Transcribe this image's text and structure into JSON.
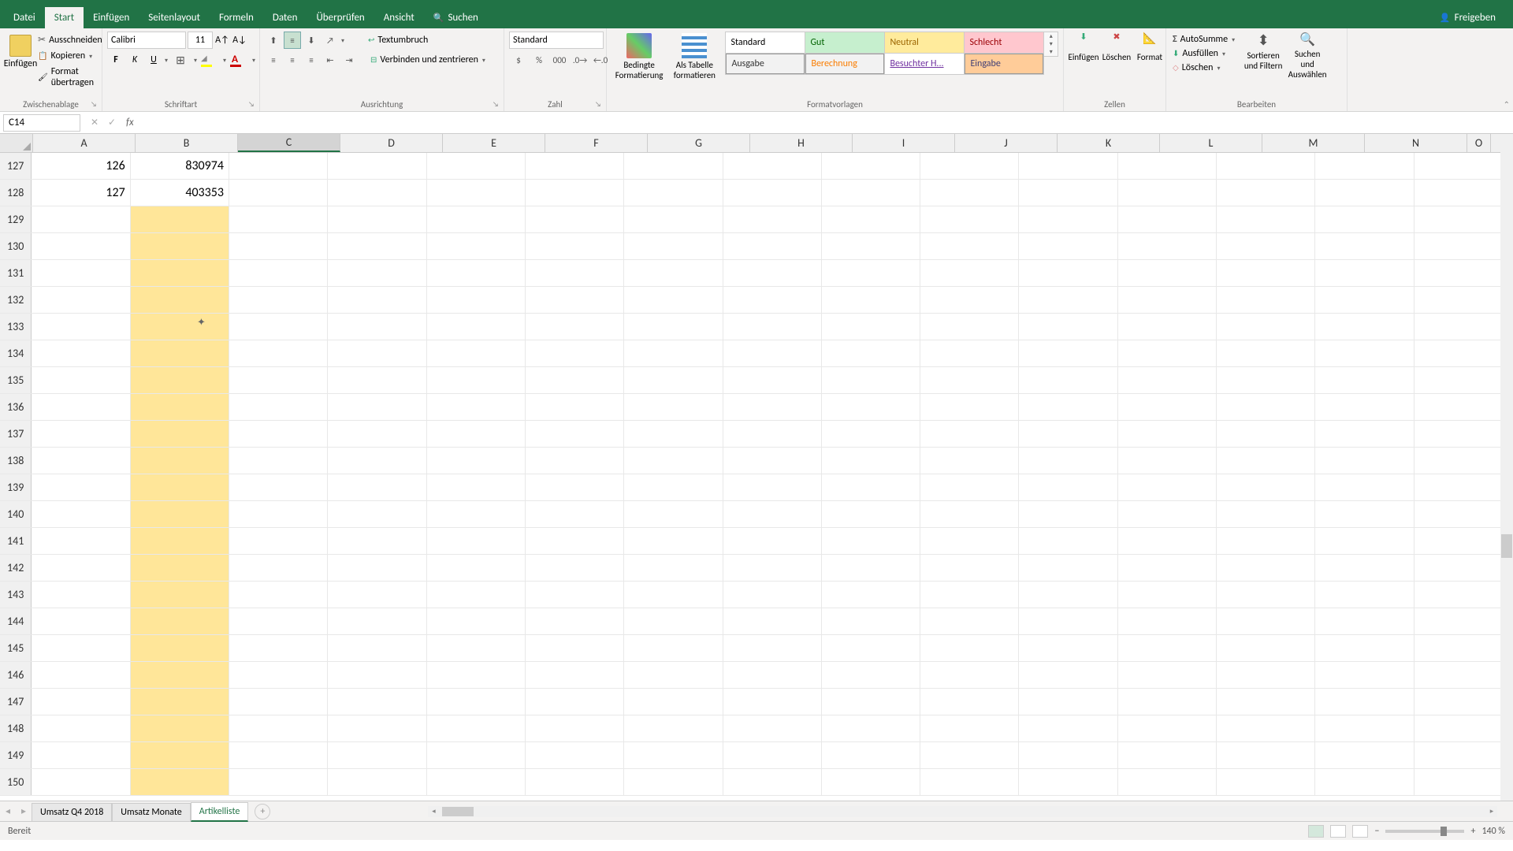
{
  "app": {
    "file_menu": "Datei",
    "share": "Freigeben"
  },
  "tabs": {
    "start": "Start",
    "einfuegen": "Einfügen",
    "seitenlayout": "Seitenlayout",
    "formeln": "Formeln",
    "daten": "Daten",
    "ueberpruefen": "Überprüfen",
    "ansicht": "Ansicht",
    "suchen": "Suchen"
  },
  "clipboard": {
    "paste": "Einfügen",
    "cut": "Ausschneiden",
    "copy": "Kopieren",
    "format_painter": "Format übertragen",
    "group": "Zwischenablage"
  },
  "font": {
    "name": "Calibri",
    "size": "11",
    "bold": "F",
    "italic": "K",
    "underline": "U",
    "group": "Schriftart"
  },
  "align": {
    "wrap": "Textumbruch",
    "merge": "Verbinden und zentrieren",
    "group": "Ausrichtung"
  },
  "number": {
    "format": "Standard",
    "group": "Zahl"
  },
  "styles": {
    "conditional": "Bedingte Formatierung",
    "as_table": "Als Tabelle formatieren",
    "standard": "Standard",
    "gut": "Gut",
    "neutral": "Neutral",
    "schlecht": "Schlecht",
    "ausgabe": "Ausgabe",
    "berechnung": "Berechnung",
    "besuchter": "Besuchter H...",
    "eingabe": "Eingabe",
    "group": "Formatvorlagen"
  },
  "cells": {
    "insert": "Einfügen",
    "delete": "Löschen",
    "format": "Format",
    "group": "Zellen"
  },
  "editing": {
    "autosum": "AutoSumme",
    "fill": "Ausfüllen",
    "clear": "Löschen",
    "sort": "Sortieren und Filtern",
    "find": "Suchen und Auswählen",
    "group": "Bearbeiten"
  },
  "namebox": {
    "cell_ref": "C14",
    "fx": "fx"
  },
  "columns": [
    "A",
    "B",
    "C",
    "D",
    "E",
    "F",
    "G",
    "H",
    "I",
    "J",
    "K",
    "L",
    "M",
    "N",
    "O"
  ],
  "rows": [
    {
      "num": "127",
      "a": "126",
      "b": "830974"
    },
    {
      "num": "128",
      "a": "127",
      "b": "403353"
    },
    {
      "num": "129",
      "a": "",
      "b": ""
    },
    {
      "num": "130",
      "a": "",
      "b": ""
    },
    {
      "num": "131",
      "a": "",
      "b": ""
    },
    {
      "num": "132",
      "a": "",
      "b": ""
    },
    {
      "num": "133",
      "a": "",
      "b": ""
    },
    {
      "num": "134",
      "a": "",
      "b": ""
    },
    {
      "num": "135",
      "a": "",
      "b": ""
    },
    {
      "num": "136",
      "a": "",
      "b": ""
    },
    {
      "num": "137",
      "a": "",
      "b": ""
    },
    {
      "num": "138",
      "a": "",
      "b": ""
    },
    {
      "num": "139",
      "a": "",
      "b": ""
    },
    {
      "num": "140",
      "a": "",
      "b": ""
    },
    {
      "num": "141",
      "a": "",
      "b": ""
    },
    {
      "num": "142",
      "a": "",
      "b": ""
    },
    {
      "num": "143",
      "a": "",
      "b": ""
    },
    {
      "num": "144",
      "a": "",
      "b": ""
    },
    {
      "num": "145",
      "a": "",
      "b": ""
    },
    {
      "num": "146",
      "a": "",
      "b": ""
    },
    {
      "num": "147",
      "a": "",
      "b": ""
    },
    {
      "num": "148",
      "a": "",
      "b": ""
    },
    {
      "num": "149",
      "a": "",
      "b": ""
    },
    {
      "num": "150",
      "a": "",
      "b": ""
    }
  ],
  "sheets": {
    "s1": "Umsatz Q4 2018",
    "s2": "Umsatz Monate",
    "s3": "Artikelliste",
    "new": "+"
  },
  "status": {
    "ready": "Bereit",
    "zoom": "140 %"
  }
}
